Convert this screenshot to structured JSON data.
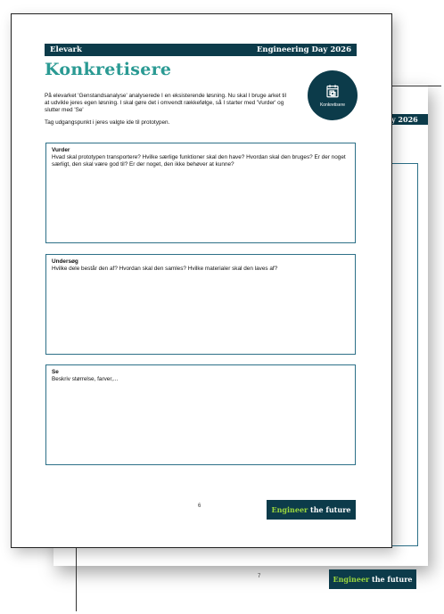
{
  "header": {
    "left": "Elevark",
    "right": "Engineering Day 2026"
  },
  "back_page": {
    "header_fragment": "y 2026",
    "page_number": "7",
    "logo": {
      "strong": "Engineer",
      "rest": " the future"
    }
  },
  "front_page": {
    "title": "Konkretisere",
    "intro": "På elevarket 'Genstandsanalyse' analyserede I en eksisterende løsning. Nu skal I bruge arket til at udvikle jeres egen løsning. I skal gøre det i omvendt rækkefølge, så I starter med 'Vurder' og slutter med 'Se'",
    "intro2": "Tag udgangspunkt i jeres valgte ide til prototypen.",
    "badge": {
      "label": "Konkretisere",
      "icon": "notepad-icon"
    },
    "sections": [
      {
        "title": "Vurder",
        "text": "Hvad skal prototypen transportere? Hvilke særlige funktioner skal den have? Hvordan skal den bruges? Er der noget særligt, den skal være god til? Er der noget, den ikke behøver at kunne?"
      },
      {
        "title": "Undersøg",
        "text": "Hvilke dele består den af? Hvordan skal den samles? Hvilke materialer skal den laves af?"
      },
      {
        "title": "Se",
        "text": "Beskriv størrelse, farver,..."
      }
    ],
    "page_number": "6",
    "logo": {
      "strong": "Engineer",
      "rest": " the future"
    }
  },
  "colors": {
    "navy": "#0c3b4a",
    "teal": "#2a9a93",
    "frame": "#2d7088",
    "logo_accent": "#9ad63d"
  }
}
